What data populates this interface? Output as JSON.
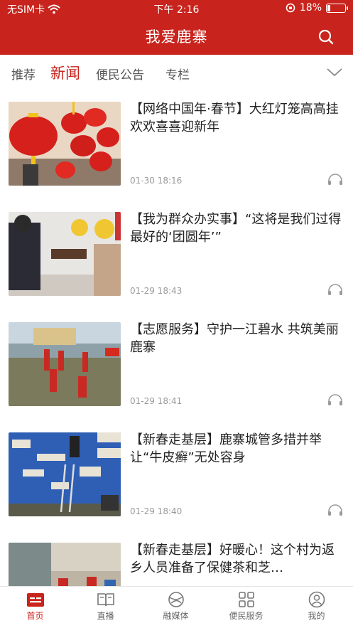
{
  "status": {
    "carrier": "无SIM卡",
    "time": "下午 2:16",
    "battery": "18%",
    "battery_level": 0.18
  },
  "header": {
    "title": "我爱鹿寨"
  },
  "tabs": [
    {
      "label": "推荐"
    },
    {
      "label": "新闻",
      "active": true
    },
    {
      "label": "便民公告"
    },
    {
      "label": "专栏"
    }
  ],
  "news": [
    {
      "headline": "【网络中国年·春节】大红灯笼高高挂 欢欢喜喜迎新年",
      "date": "01-30 18:16"
    },
    {
      "headline": "【我为群众办实事】“这将是我们过得最好的‘团圆年’”",
      "date": "01-29 18:43"
    },
    {
      "headline": "【志愿服务】守护一江碧水 共筑美丽鹿寨",
      "date": "01-29 18:41"
    },
    {
      "headline": "【新春走基层】鹿寨城管多措并举让“牛皮癣”无处容身",
      "date": "01-29 18:40"
    },
    {
      "headline": "【新春走基层】好暖心！这个村为返乡人员准备了保健茶和芝…",
      "date": ""
    }
  ],
  "bottom_nav": [
    {
      "label": "首页",
      "icon": "home-icon",
      "active": true
    },
    {
      "label": "直播",
      "icon": "book-icon"
    },
    {
      "label": "融媒体",
      "icon": "globe-icon"
    },
    {
      "label": "便民服务",
      "icon": "grid-icon"
    },
    {
      "label": "我的",
      "icon": "user-icon"
    }
  ],
  "colors": {
    "brand": "#c8241d"
  }
}
